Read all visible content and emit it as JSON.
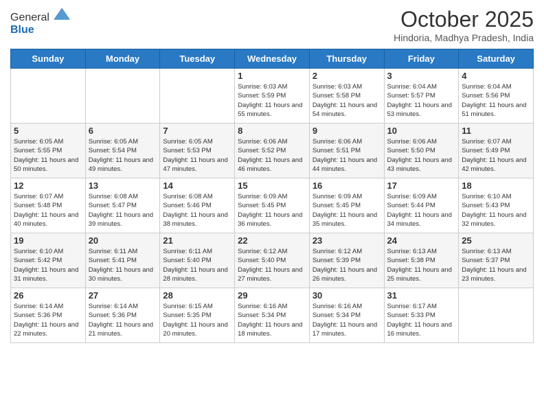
{
  "header": {
    "logo_general": "General",
    "logo_blue": "Blue",
    "title": "October 2025",
    "location": "Hindoria, Madhya Pradesh, India"
  },
  "days_of_week": [
    "Sunday",
    "Monday",
    "Tuesday",
    "Wednesday",
    "Thursday",
    "Friday",
    "Saturday"
  ],
  "weeks": [
    [
      {
        "date": "",
        "info": ""
      },
      {
        "date": "",
        "info": ""
      },
      {
        "date": "",
        "info": ""
      },
      {
        "date": "1",
        "info": "Sunrise: 6:03 AM\nSunset: 5:59 PM\nDaylight: 11 hours and 55 minutes."
      },
      {
        "date": "2",
        "info": "Sunrise: 6:03 AM\nSunset: 5:58 PM\nDaylight: 11 hours and 54 minutes."
      },
      {
        "date": "3",
        "info": "Sunrise: 6:04 AM\nSunset: 5:57 PM\nDaylight: 11 hours and 53 minutes."
      },
      {
        "date": "4",
        "info": "Sunrise: 6:04 AM\nSunset: 5:56 PM\nDaylight: 11 hours and 51 minutes."
      }
    ],
    [
      {
        "date": "5",
        "info": "Sunrise: 6:05 AM\nSunset: 5:55 PM\nDaylight: 11 hours and 50 minutes."
      },
      {
        "date": "6",
        "info": "Sunrise: 6:05 AM\nSunset: 5:54 PM\nDaylight: 11 hours and 49 minutes."
      },
      {
        "date": "7",
        "info": "Sunrise: 6:05 AM\nSunset: 5:53 PM\nDaylight: 11 hours and 47 minutes."
      },
      {
        "date": "8",
        "info": "Sunrise: 6:06 AM\nSunset: 5:52 PM\nDaylight: 11 hours and 46 minutes."
      },
      {
        "date": "9",
        "info": "Sunrise: 6:06 AM\nSunset: 5:51 PM\nDaylight: 11 hours and 44 minutes."
      },
      {
        "date": "10",
        "info": "Sunrise: 6:06 AM\nSunset: 5:50 PM\nDaylight: 11 hours and 43 minutes."
      },
      {
        "date": "11",
        "info": "Sunrise: 6:07 AM\nSunset: 5:49 PM\nDaylight: 11 hours and 42 minutes."
      }
    ],
    [
      {
        "date": "12",
        "info": "Sunrise: 6:07 AM\nSunset: 5:48 PM\nDaylight: 11 hours and 40 minutes."
      },
      {
        "date": "13",
        "info": "Sunrise: 6:08 AM\nSunset: 5:47 PM\nDaylight: 11 hours and 39 minutes."
      },
      {
        "date": "14",
        "info": "Sunrise: 6:08 AM\nSunset: 5:46 PM\nDaylight: 11 hours and 38 minutes."
      },
      {
        "date": "15",
        "info": "Sunrise: 6:09 AM\nSunset: 5:45 PM\nDaylight: 11 hours and 36 minutes."
      },
      {
        "date": "16",
        "info": "Sunrise: 6:09 AM\nSunset: 5:45 PM\nDaylight: 11 hours and 35 minutes."
      },
      {
        "date": "17",
        "info": "Sunrise: 6:09 AM\nSunset: 5:44 PM\nDaylight: 11 hours and 34 minutes."
      },
      {
        "date": "18",
        "info": "Sunrise: 6:10 AM\nSunset: 5:43 PM\nDaylight: 11 hours and 32 minutes."
      }
    ],
    [
      {
        "date": "19",
        "info": "Sunrise: 6:10 AM\nSunset: 5:42 PM\nDaylight: 11 hours and 31 minutes."
      },
      {
        "date": "20",
        "info": "Sunrise: 6:11 AM\nSunset: 5:41 PM\nDaylight: 11 hours and 30 minutes."
      },
      {
        "date": "21",
        "info": "Sunrise: 6:11 AM\nSunset: 5:40 PM\nDaylight: 11 hours and 28 minutes."
      },
      {
        "date": "22",
        "info": "Sunrise: 6:12 AM\nSunset: 5:40 PM\nDaylight: 11 hours and 27 minutes."
      },
      {
        "date": "23",
        "info": "Sunrise: 6:12 AM\nSunset: 5:39 PM\nDaylight: 11 hours and 26 minutes."
      },
      {
        "date": "24",
        "info": "Sunrise: 6:13 AM\nSunset: 5:38 PM\nDaylight: 11 hours and 25 minutes."
      },
      {
        "date": "25",
        "info": "Sunrise: 6:13 AM\nSunset: 5:37 PM\nDaylight: 11 hours and 23 minutes."
      }
    ],
    [
      {
        "date": "26",
        "info": "Sunrise: 6:14 AM\nSunset: 5:36 PM\nDaylight: 11 hours and 22 minutes."
      },
      {
        "date": "27",
        "info": "Sunrise: 6:14 AM\nSunset: 5:36 PM\nDaylight: 11 hours and 21 minutes."
      },
      {
        "date": "28",
        "info": "Sunrise: 6:15 AM\nSunset: 5:35 PM\nDaylight: 11 hours and 20 minutes."
      },
      {
        "date": "29",
        "info": "Sunrise: 6:16 AM\nSunset: 5:34 PM\nDaylight: 11 hours and 18 minutes."
      },
      {
        "date": "30",
        "info": "Sunrise: 6:16 AM\nSunset: 5:34 PM\nDaylight: 11 hours and 17 minutes."
      },
      {
        "date": "31",
        "info": "Sunrise: 6:17 AM\nSunset: 5:33 PM\nDaylight: 11 hours and 16 minutes."
      },
      {
        "date": "",
        "info": ""
      }
    ]
  ]
}
